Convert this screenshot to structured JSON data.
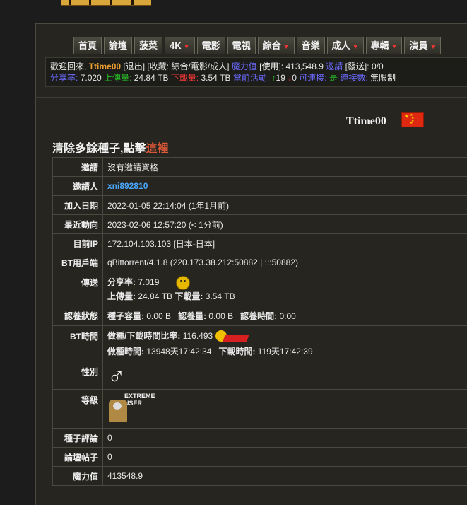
{
  "nav": {
    "items": [
      {
        "label": "首頁",
        "dropdown": false
      },
      {
        "label": "論壇",
        "dropdown": false
      },
      {
        "label": "菠菜",
        "dropdown": false
      },
      {
        "label": "4K",
        "dropdown": true
      },
      {
        "label": "電影",
        "dropdown": false
      },
      {
        "label": "電視",
        "dropdown": false
      },
      {
        "label": "綜合",
        "dropdown": true
      },
      {
        "label": "音樂",
        "dropdown": false
      },
      {
        "label": "成人",
        "dropdown": true
      },
      {
        "label": "專輯",
        "dropdown": true
      },
      {
        "label": "演員",
        "dropdown": true
      }
    ]
  },
  "status": {
    "welcome": "歡迎回來,",
    "user": "Ttime00",
    "logout": "[退出]",
    "favorites": "[收藏: 綜合/電影/成人]",
    "magic_label": "魔力值",
    "magic_use": "[使用]:",
    "magic_value": "413,548.9",
    "invite_label": "邀請",
    "invite_send": "[發送]:",
    "invite_value": "0/0",
    "ratio_label": "分享率:",
    "ratio_value": "7.020",
    "upload_label": "上傳量:",
    "upload_value": "24.84 TB",
    "download_label": "下載量:",
    "download_value": "3.54 TB",
    "active_label": "當前活動:",
    "active_up": "19",
    "active_down": "0",
    "connectable_label": "可連接:",
    "connectable_value": "是",
    "connections_label": "連接數:",
    "connections_value": "無限制"
  },
  "profile": {
    "username": "Ttime00",
    "clean_text": "清除多餘種子,點擊",
    "clean_link": "這裡"
  },
  "rows": {
    "invite": {
      "label": "邀請",
      "value": "沒有邀請資格"
    },
    "inviter": {
      "label": "邀請人",
      "value": "xni892810"
    },
    "joined": {
      "label": "加入日期",
      "value": "2022-01-05 22:14:04 (1年1月前)"
    },
    "last_action": {
      "label": "最近動向",
      "value": "2023-02-06 12:57:20 (< 1分前)"
    },
    "ip": {
      "label": "目前IP",
      "value": "172.104.103.103 [日本-日本]"
    },
    "client": {
      "label": "BT用戶端",
      "value": "qBittorrent/4.1.8 (220.173.38.212:50882 | :::50882)"
    },
    "transfer": {
      "label": "傳送",
      "ratio_label": "分享率:",
      "ratio_value": "7.019",
      "up_label": "上傳量:",
      "up_value": "24.84 TB",
      "down_label": "下載量:",
      "down_value": "3.54 TB"
    },
    "seedbonus": {
      "label": "認養狀態",
      "cap_label": "種子容量:",
      "cap_value": "0.00 B",
      "amt_label": "認養量:",
      "amt_value": "0.00 B",
      "time_label": "認養時間:",
      "time_value": "0:00"
    },
    "bttime": {
      "label": "BT時間",
      "ratio_label": "做種/下載時間比率:",
      "ratio_value": "116.493",
      "seed_label": "做種時間:",
      "seed_value": "13948天17:42:34",
      "leech_label": "下載時間:",
      "leech_value": "119天17:42:39"
    },
    "gender": {
      "label": "性別",
      "value": "♂"
    },
    "class": {
      "label": "等級",
      "value": "EXTREME USER"
    },
    "comments": {
      "label": "種子評論",
      "value": "0"
    },
    "posts": {
      "label": "論壇帖子",
      "value": "0"
    },
    "magic": {
      "label": "魔力值",
      "value": "413548.9"
    }
  }
}
